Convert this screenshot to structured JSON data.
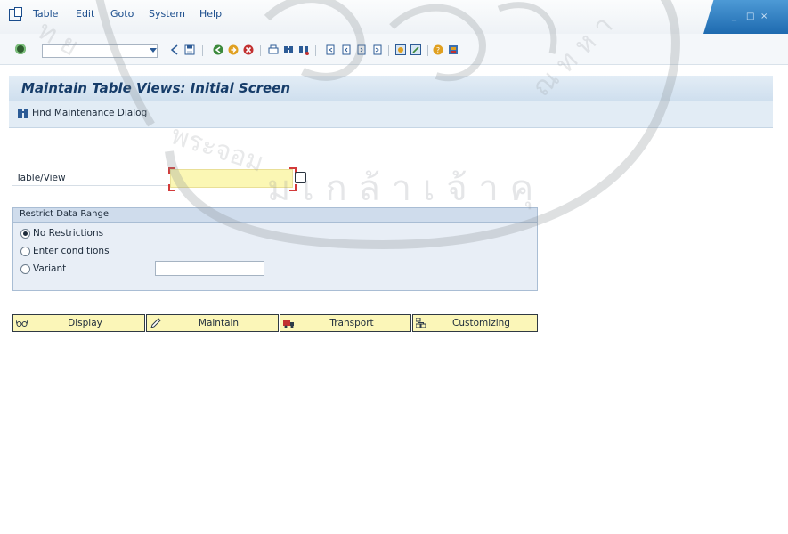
{
  "menubar": {
    "items": [
      "Table",
      "Edit",
      "Goto",
      "System",
      "Help"
    ],
    "window_controls": [
      "_",
      "□",
      "×"
    ]
  },
  "toolbar": {
    "command_field": {
      "value": "",
      "placeholder": ""
    },
    "icons": [
      "enter-icon",
      "back-icon",
      "save-icon",
      "back-green-icon",
      "exit-icon",
      "cancel-icon",
      "print-icon",
      "find-icon",
      "find-next-icon",
      "first-page-icon",
      "previous-page-icon",
      "next-page-icon",
      "last-page-icon",
      "create-session-icon",
      "shortcut-icon",
      "help-icon",
      "customize-icon"
    ]
  },
  "header": {
    "title": "Maintain Table Views: Initial Screen"
  },
  "appbar": {
    "find_label": "Find Maintenance Dialog"
  },
  "form": {
    "table_view_label": "Table/View",
    "table_view_value": "",
    "group": {
      "title": "Restrict Data Range",
      "options": [
        {
          "label": "No Restrictions",
          "selected": true
        },
        {
          "label": "Enter conditions",
          "selected": false
        },
        {
          "label": "Variant",
          "selected": false
        }
      ],
      "variant_value": ""
    }
  },
  "buttons": [
    "Display",
    "Maintain",
    "Transport",
    "Customizing"
  ],
  "colors": {
    "title_text": "#163c69",
    "required_field": "#fbf7b4",
    "button_bg": "#fbf6b8",
    "menu_text": "#1a4c8c",
    "window_controls": "#1e6ab0"
  }
}
